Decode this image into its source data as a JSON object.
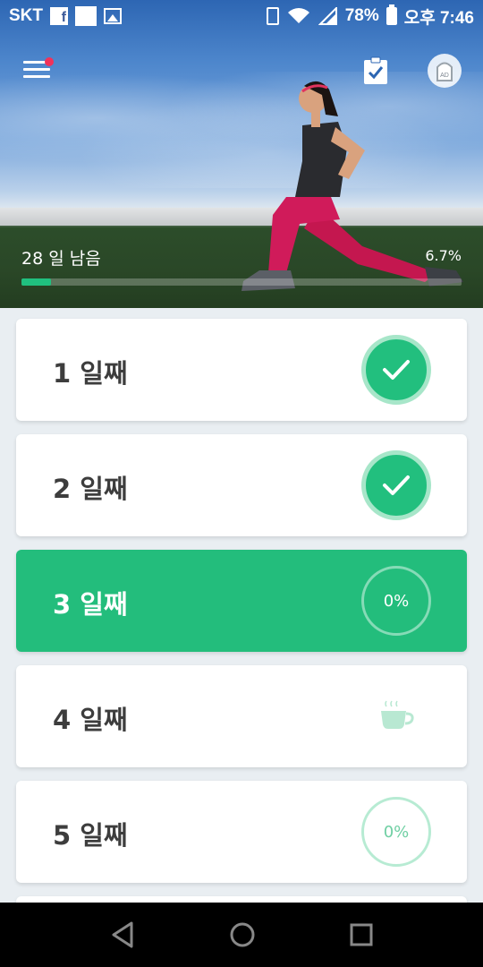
{
  "status_bar": {
    "carrier": "SKT",
    "battery": "78%",
    "time": "오후 7:46"
  },
  "hero": {
    "days_remaining": "28 일 남음",
    "progress_percent": "6.7%",
    "progress_value": 0.067,
    "accent_color": "#20c07f"
  },
  "days": [
    {
      "label": "1 일째",
      "status": "done"
    },
    {
      "label": "2 일째",
      "status": "done"
    },
    {
      "label": "3 일째",
      "status": "current",
      "percent": "0%"
    },
    {
      "label": "4 일째",
      "status": "rest"
    },
    {
      "label": "5 일째",
      "status": "pending",
      "percent": "0%"
    }
  ],
  "icons": {
    "menu": "hamburger-menu-icon",
    "plan": "clipboard-check-icon",
    "ad": "remove-ads-icon",
    "done": "checkmark-icon",
    "rest": "coffee-cup-icon"
  }
}
